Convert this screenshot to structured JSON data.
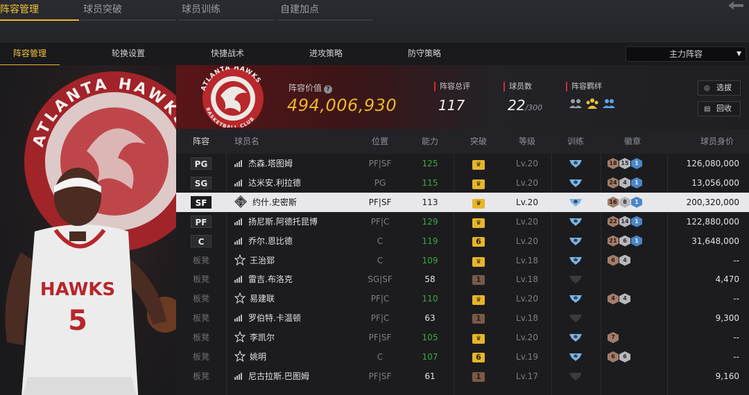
{
  "top_tabs": [
    {
      "label": "阵容管理",
      "active": true
    },
    {
      "label": "球员突破",
      "active": false
    },
    {
      "label": "球员训练",
      "active": false
    },
    {
      "label": "自建加点",
      "active": false
    }
  ],
  "sub_tabs": [
    {
      "label": "阵容管理",
      "active": true
    },
    {
      "label": "轮换设置",
      "active": false
    },
    {
      "label": "快捷战术",
      "active": false
    },
    {
      "label": "进攻策略",
      "active": false
    },
    {
      "label": "防守策略",
      "active": false
    }
  ],
  "lineup_select": {
    "value": "主力阵容"
  },
  "hero": {
    "jersey_name": "HAWKS",
    "jersey_number": "5",
    "logo_text": "ATLANTA HAWKS"
  },
  "info": {
    "logo_text_top": "ATLANTA HAWKS",
    "logo_text_bottom": "BASKETBALL CLUB",
    "value_label": "阵容价值",
    "value": "494,006,930",
    "rating_label": "阵容总评",
    "rating": "117",
    "count_label": "球员数",
    "count": "22",
    "count_max": "/300",
    "bonds_label": "阵容羁绊",
    "select_button": "选拔",
    "recycle_button": "回收"
  },
  "colors": {
    "accent": "#f0b62a",
    "green": "#3fa83f",
    "red": "#d52b2b",
    "blue": "#4a87c7"
  },
  "table": {
    "headers": {
      "lineup": "阵容",
      "name": "球员名",
      "position": "位置",
      "ability": "能力",
      "breakthrough": "突破",
      "level": "等级",
      "training": "训练",
      "badges": "徽章",
      "salary": "球员身价"
    },
    "rows": [
      {
        "slot": "PG",
        "starter": true,
        "icon": "signal",
        "name": "杰森.塔图姆",
        "position": "PF|SF",
        "ability": "125",
        "ability_color": "green",
        "break": "crown",
        "level": "Lv.20",
        "training": true,
        "badges": [
          {
            "t": "bronze",
            "v": "18"
          },
          {
            "t": "silver",
            "v": "15"
          },
          {
            "t": "blue",
            "v": "1"
          }
        ],
        "salary": "126,080,000"
      },
      {
        "slot": "SG",
        "starter": true,
        "icon": "signal",
        "name": "达米安.利拉德",
        "position": "PG",
        "ability": "115",
        "ability_color": "green",
        "break": "crown",
        "level": "Lv.20",
        "training": true,
        "badges": [
          {
            "t": "bronze",
            "v": "24"
          },
          {
            "t": "silver",
            "v": "4"
          },
          {
            "t": "blue",
            "v": "1"
          }
        ],
        "salary": "13,056,000"
      },
      {
        "slot": "SF",
        "starter": true,
        "selected": true,
        "icon": "diamond",
        "icon_text": "09",
        "name": "约什.史密斯",
        "position": "PF|SF",
        "ability": "113",
        "ability_color": "white",
        "break": "crown",
        "level": "Lv.20",
        "training": true,
        "badges": [
          {
            "t": "bronze",
            "v": "16"
          },
          {
            "t": "silver",
            "v": "8"
          },
          {
            "t": "blue",
            "v": "1"
          }
        ],
        "salary": "200,320,000"
      },
      {
        "slot": "PF",
        "starter": true,
        "icon": "signal",
        "name": "扬尼斯.阿德托昆博",
        "position": "PF|C",
        "ability": "129",
        "ability_color": "green",
        "break": "crown",
        "level": "Lv.20",
        "training": true,
        "badges": [
          {
            "t": "bronze",
            "v": "22"
          },
          {
            "t": "silver",
            "v": "14"
          },
          {
            "t": "blue",
            "v": "1"
          }
        ],
        "salary": "122,880,000"
      },
      {
        "slot": "C",
        "starter": true,
        "icon": "signal",
        "name": "乔尔.恩比德",
        "position": "C",
        "ability": "119",
        "ability_color": "green",
        "break": "6",
        "level": "Lv.20",
        "training": true,
        "badges": [
          {
            "t": "bronze",
            "v": "21"
          },
          {
            "t": "silver",
            "v": "6"
          },
          {
            "t": "blue",
            "v": "1"
          }
        ],
        "salary": "31,648,000"
      },
      {
        "slot": "板凳",
        "starter": false,
        "icon": "star",
        "name": "王治郅",
        "position": "C",
        "ability": "109",
        "ability_color": "green",
        "break": "crown",
        "level": "Lv.18",
        "training": true,
        "badges": [
          {
            "t": "bronze",
            "v": "6"
          },
          {
            "t": "silver",
            "v": "4"
          }
        ],
        "salary": "--"
      },
      {
        "slot": "板凳",
        "starter": false,
        "icon": "signal",
        "name": "雷吉.布洛克",
        "position": "SG|SF",
        "ability": "58",
        "ability_color": "white",
        "break": "1",
        "level": "Lv.18",
        "training": false,
        "badges": [],
        "salary": "4,470"
      },
      {
        "slot": "板凳",
        "starter": false,
        "icon": "star",
        "name": "易建联",
        "position": "PF|C",
        "ability": "110",
        "ability_color": "green",
        "break": "crown",
        "level": "Lv.20",
        "training": true,
        "badges": [
          {
            "t": "bronze",
            "v": "4"
          },
          {
            "t": "silver",
            "v": "4"
          }
        ],
        "salary": "--"
      },
      {
        "slot": "板凳",
        "starter": false,
        "icon": "signal",
        "name": "罗伯特.卡温顿",
        "position": "PF|C",
        "ability": "63",
        "ability_color": "white",
        "break": "1",
        "level": "Lv.18",
        "training": false,
        "badges": [],
        "salary": "9,300"
      },
      {
        "slot": "板凳",
        "starter": false,
        "icon": "star",
        "name": "李凯尔",
        "position": "PF|SF",
        "ability": "105",
        "ability_color": "green",
        "break": "crown",
        "level": "Lv.20",
        "training": true,
        "badges": [
          {
            "t": "bronze",
            "v": "7"
          }
        ],
        "salary": "--"
      },
      {
        "slot": "板凳",
        "starter": false,
        "icon": "star",
        "name": "姚明",
        "position": "C",
        "ability": "107",
        "ability_color": "green",
        "break": "6",
        "level": "Lv.19",
        "training": true,
        "badges": [
          {
            "t": "bronze",
            "v": "6"
          },
          {
            "t": "silver",
            "v": "6"
          }
        ],
        "salary": "--"
      },
      {
        "slot": "板凳",
        "starter": false,
        "icon": "signal",
        "name": "尼古拉斯.巴图姆",
        "position": "PF|SF",
        "ability": "61",
        "ability_color": "white",
        "break": "1",
        "level": "Lv.17",
        "training": false,
        "badges": [],
        "salary": "9,160"
      }
    ]
  }
}
